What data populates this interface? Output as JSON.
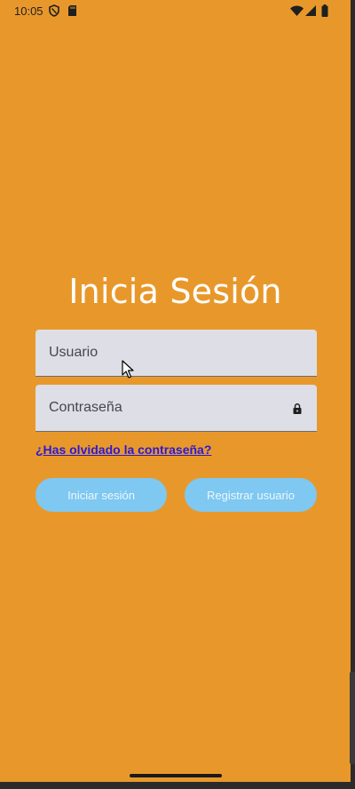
{
  "status_bar": {
    "time": "10:05",
    "icons": [
      "shield-icon",
      "sd-card-icon",
      "wifi-icon",
      "signal-icon",
      "battery-icon"
    ]
  },
  "login": {
    "title": "Inicia Sesión",
    "username_placeholder": "Usuario",
    "password_placeholder": "Contraseña",
    "forgot_password_link": "¿Has olvidado la contraseña?",
    "login_button": "Iniciar sesión",
    "register_button": "Registrar usuario"
  },
  "colors": {
    "background": "#E8982B",
    "field_background": "#DEDEE6",
    "button_background": "#7EC8F1",
    "link": "#2A1AD6",
    "title": "#FFFFFF"
  }
}
